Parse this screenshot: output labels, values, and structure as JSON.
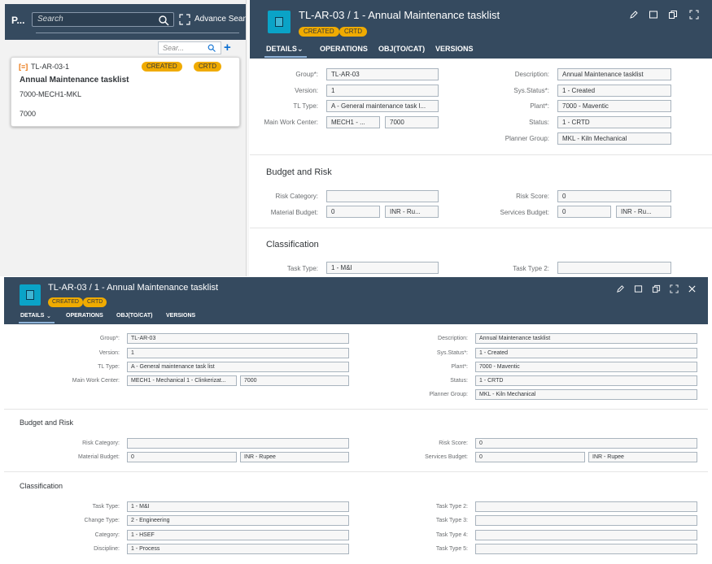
{
  "colors": {
    "shell_bg": "#354a5f",
    "accent": "#0aa3c7",
    "badge": "#f0ab00"
  },
  "list_pane": {
    "title_short": "P...",
    "search_placeholder": "Search",
    "advance_search_label": "Advance Sean",
    "sub_search_placeholder": "Sear...",
    "add_label": "+",
    "card": {
      "id": "TL-AR-03-1",
      "badges": [
        "CREATED",
        "CRTD"
      ],
      "title": "Annual Maintenance tasklist",
      "line2": "7000-MECH1-MKL",
      "line3": "7000"
    }
  },
  "object_top": {
    "title": "TL-AR-03 / 1 - Annual Maintenance tasklist",
    "badges": [
      "CREATED",
      "CRTD"
    ],
    "tabs": [
      "DETAILS",
      "OPERATIONS",
      "OBJ(TO/CAT)",
      "VERSIONS"
    ],
    "details": {
      "group_label": "Group*:",
      "group_value": "TL-AR-03",
      "version_label": "Version:",
      "version_value": "1",
      "tltype_label": "TL Type:",
      "tltype_value": "A - General maintenance task l...",
      "mwc_label": "Main Work Center:",
      "mwc_value": "MECH1 - ...",
      "mwc_plant": "7000",
      "desc_label": "Description:",
      "desc_value": "Annual Maintenance tasklist",
      "sysstatus_label": "Sys.Status*:",
      "sysstatus_value": "1 - Created",
      "plant_label": "Plant*:",
      "plant_value": "7000 - Maventic",
      "status_label": "Status:",
      "status_value": "1 - CRTD",
      "planner_label": "Planner Group:",
      "planner_value": "MKL - Kiln Mechanical"
    },
    "budget": {
      "title": "Budget and Risk",
      "risk_cat_label": "Risk Category:",
      "risk_cat_value": "",
      "mat_budget_label": "Material Budget:",
      "mat_budget_value": "0",
      "mat_currency": "INR - Ru...",
      "risk_score_label": "Risk Score:",
      "risk_score_value": "0",
      "svc_budget_label": "Services Budget:",
      "svc_budget_value": "0",
      "svc_currency": "INR - Ru..."
    },
    "classification": {
      "title": "Classification",
      "task_type_label": "Task Type:",
      "task_type_value": "1 - M&I",
      "task_type2_label": "Task Type 2:",
      "task_type2_value": ""
    }
  },
  "object_bottom": {
    "title": "TL-AR-03 / 1 - Annual Maintenance tasklist",
    "badges": [
      "CREATED",
      "CRTD"
    ],
    "tabs": [
      "DETAILS",
      "OPERATIONS",
      "OBJ(TO/CAT)",
      "VERSIONS"
    ],
    "details": {
      "group_label": "Group*:",
      "group_value": "TL-AR-03",
      "version_label": "Version:",
      "version_value": "1",
      "tltype_label": "TL Type:",
      "tltype_value": "A - General maintenance task list",
      "mwc_label": "Main Work Center:",
      "mwc_value": "MECH1 - Mechanical 1 - Clinkerizat...",
      "mwc_plant": "7000",
      "desc_label": "Description:",
      "desc_value": "Annual Maintenance tasklist",
      "sysstatus_label": "Sys.Status*:",
      "sysstatus_value": "1 - Created",
      "plant_label": "Plant*:",
      "plant_value": "7000 - Maventic",
      "status_label": "Status:",
      "status_value": "1 - CRTD",
      "planner_label": "Planner Group:",
      "planner_value": "MKL - Kiln Mechanical"
    },
    "budget": {
      "title": "Budget and Risk",
      "risk_cat_label": "Risk Category:",
      "risk_cat_value": "",
      "mat_budget_label": "Material Budget:",
      "mat_budget_value": "0",
      "mat_currency": "INR - Rupee",
      "risk_score_label": "Risk Score:",
      "risk_score_value": "0",
      "svc_budget_label": "Services Budget:",
      "svc_budget_value": "0",
      "svc_currency": "INR - Rupee"
    },
    "classification": {
      "title": "Classification",
      "task_type_label": "Task Type:",
      "task_type_value": "1 - M&I",
      "change_type_label": "Change Type:",
      "change_type_value": "2 - Engineering",
      "category_label": "Category:",
      "category_value": "1 - HSEF",
      "discipline_label": "Discipline:",
      "discipline_value": "1 - Process",
      "task_type2_label": "Task Type 2:",
      "task_type2_value": "",
      "task_type3_label": "Task Type 3:",
      "task_type3_value": "",
      "task_type4_label": "Task Type 4:",
      "task_type4_value": "",
      "task_type5_label": "Task Type 5:",
      "task_type5_value": ""
    }
  }
}
